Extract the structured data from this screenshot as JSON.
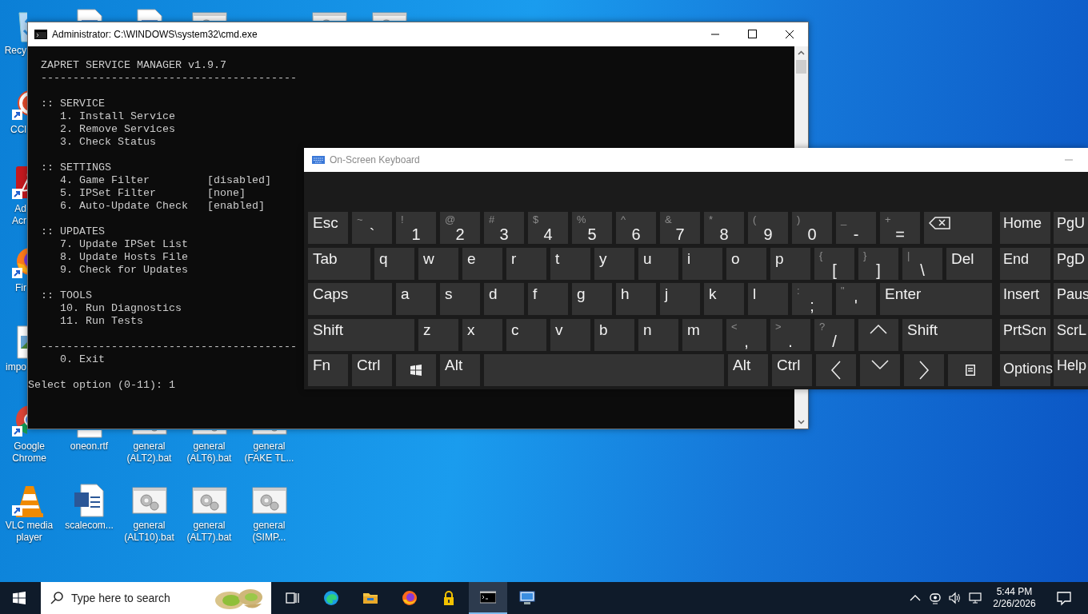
{
  "desktop_icons": [
    {
      "kind": "recycle-bin",
      "label": "Recy"
    },
    {
      "kind": "document"
    },
    {
      "kind": "document"
    },
    {
      "kind": "batch"
    },
    {
      "kind": "batch"
    },
    {
      "kind": "batch"
    },
    {
      "kind": "cleaner",
      "label": "CCl"
    },
    {
      "kind": "pdf",
      "label": "Ad Acr"
    },
    {
      "kind": "firefox",
      "label": "Fir"
    },
    {
      "kind": "image",
      "label": "impo"
    },
    {
      "kind": "chrome",
      "label": "Google Chrome"
    },
    {
      "kind": "rtf",
      "label": "oneon.rtf"
    },
    {
      "kind": "batch",
      "label": "general (ALT2).bat"
    },
    {
      "kind": "batch",
      "label": "general (ALT6).bat"
    },
    {
      "kind": "batch",
      "label": "general (FAKE TL..."
    },
    {
      "kind": "vlc",
      "label": "VLC media player"
    },
    {
      "kind": "word",
      "label": "scalecom..."
    },
    {
      "kind": "batch",
      "label": "general (ALT10).bat"
    },
    {
      "kind": "batch",
      "label": "general (ALT7).bat"
    },
    {
      "kind": "batch",
      "label": "general (SIMP..."
    }
  ],
  "console_window": {
    "title": "Administrator: C:\\WINDOWS\\system32\\cmd.exe",
    "heading": "ZAPRET SERVICE MANAGER v1.9.7",
    "rule": "----------------------------------------",
    "sections": [
      {
        "title": ":: SERVICE",
        "items": [
          {
            "label": "1. Install Service"
          },
          {
            "label": "2. Remove Services"
          },
          {
            "label": "3. Check Status"
          }
        ]
      },
      {
        "title": ":: SETTINGS",
        "items": [
          {
            "label": "4. Game Filter",
            "value": "[disabled]"
          },
          {
            "label": "5. IPSet Filter",
            "value": "[none]"
          },
          {
            "label": "6. Auto-Update Check",
            "value": "[enabled]"
          }
        ]
      },
      {
        "title": ":: UPDATES",
        "items": [
          {
            "label": "7. Update IPSet List"
          },
          {
            "label": "8. Update Hosts File"
          },
          {
            "label": "9. Check for Updates"
          }
        ]
      },
      {
        "title": ":: TOOLS",
        "items": [
          {
            "label": "10. Run Diagnostics"
          },
          {
            "label": "11. Run Tests"
          }
        ]
      }
    ],
    "footer_rule": "----------------------------------------",
    "exit_item": "0. Exit",
    "prompt": "Select option (0-11): 1"
  },
  "keyboard_window": {
    "title": "On-Screen Keyboard",
    "main_rows": [
      {
        "keys": [
          {
            "kind": "function",
            "label": "Esc"
          },
          {
            "kind": "symbol",
            "shift": "~",
            "base": "`"
          },
          {
            "kind": "symbol",
            "shift": "!",
            "base": "1"
          },
          {
            "kind": "symbol",
            "shift": "@",
            "base": "2"
          },
          {
            "kind": "symbol",
            "shift": "#",
            "base": "3"
          },
          {
            "kind": "symbol",
            "shift": "$",
            "base": "4"
          },
          {
            "kind": "symbol",
            "shift": "%",
            "base": "5"
          },
          {
            "kind": "symbol",
            "shift": "^",
            "base": "6"
          },
          {
            "kind": "symbol",
            "shift": "&",
            "base": "7"
          },
          {
            "kind": "symbol",
            "shift": "*",
            "base": "8"
          },
          {
            "kind": "symbol",
            "shift": "(",
            "base": "9"
          },
          {
            "kind": "symbol",
            "shift": ")",
            "base": "0"
          },
          {
            "kind": "symbol",
            "shift": "_",
            "base": "-"
          },
          {
            "kind": "symbol",
            "shift": "+",
            "base": "="
          },
          {
            "kind": "backspace"
          }
        ]
      },
      {
        "keys": [
          {
            "kind": "function",
            "label": "Tab"
          },
          {
            "kind": "letter",
            "label": "q"
          },
          {
            "kind": "letter",
            "label": "w"
          },
          {
            "kind": "letter",
            "label": "e"
          },
          {
            "kind": "letter",
            "label": "r"
          },
          {
            "kind": "letter",
            "label": "t"
          },
          {
            "kind": "letter",
            "label": "y"
          },
          {
            "kind": "letter",
            "label": "u"
          },
          {
            "kind": "letter",
            "label": "i"
          },
          {
            "kind": "letter",
            "label": "o"
          },
          {
            "kind": "letter",
            "label": "p"
          },
          {
            "kind": "symbol",
            "shift": "{",
            "base": "["
          },
          {
            "kind": "symbol",
            "shift": "}",
            "base": "]"
          },
          {
            "kind": "symbol",
            "shift": "|",
            "base": "\\"
          },
          {
            "kind": "function",
            "label": "Del"
          }
        ]
      },
      {
        "keys": [
          {
            "kind": "function",
            "label": "Caps"
          },
          {
            "kind": "letter",
            "label": "a"
          },
          {
            "kind": "letter",
            "label": "s"
          },
          {
            "kind": "letter",
            "label": "d"
          },
          {
            "kind": "letter",
            "label": "f"
          },
          {
            "kind": "letter",
            "label": "g"
          },
          {
            "kind": "letter",
            "label": "h"
          },
          {
            "kind": "letter",
            "label": "j"
          },
          {
            "kind": "letter",
            "label": "k"
          },
          {
            "kind": "letter",
            "label": "l"
          },
          {
            "kind": "symbol",
            "shift": ":",
            "base": ";"
          },
          {
            "kind": "symbol",
            "shift": "\"",
            "base": "'"
          },
          {
            "kind": "function",
            "label": "Enter"
          }
        ]
      },
      {
        "keys": [
          {
            "kind": "function",
            "label": "Shift"
          },
          {
            "kind": "letter",
            "label": "z"
          },
          {
            "kind": "letter",
            "label": "x"
          },
          {
            "kind": "letter",
            "label": "c"
          },
          {
            "kind": "letter",
            "label": "v"
          },
          {
            "kind": "letter",
            "label": "b"
          },
          {
            "kind": "letter",
            "label": "n"
          },
          {
            "kind": "letter",
            "label": "m"
          },
          {
            "kind": "symbol",
            "shift": "<",
            "base": ","
          },
          {
            "kind": "symbol",
            "shift": ">",
            "base": "."
          },
          {
            "kind": "symbol",
            "shift": "?",
            "base": "/"
          },
          {
            "kind": "up"
          },
          {
            "kind": "function",
            "label": "Shift"
          }
        ]
      },
      {
        "keys": [
          {
            "kind": "function",
            "label": "Fn"
          },
          {
            "kind": "function",
            "label": "Ctrl"
          },
          {
            "kind": "windows"
          },
          {
            "kind": "function",
            "label": "Alt"
          },
          {
            "kind": "space"
          },
          {
            "kind": "function",
            "label": "Alt"
          },
          {
            "kind": "function",
            "label": "Ctrl"
          },
          {
            "kind": "left"
          },
          {
            "kind": "down"
          },
          {
            "kind": "right"
          },
          {
            "kind": "menu"
          }
        ]
      }
    ],
    "side_rows": [
      {
        "keys": [
          {
            "kind": "function",
            "label": "Home"
          },
          {
            "kind": "function",
            "label": "PgU"
          }
        ]
      },
      {
        "keys": [
          {
            "kind": "function",
            "label": "End"
          },
          {
            "kind": "function",
            "label": "PgD"
          }
        ]
      },
      {
        "keys": [
          {
            "kind": "function",
            "label": "Insert"
          },
          {
            "kind": "function",
            "label": "Paus"
          }
        ]
      },
      {
        "keys": [
          {
            "kind": "function",
            "label": "PrtScn"
          },
          {
            "kind": "function",
            "label": "ScrL"
          }
        ]
      },
      {
        "keys": [
          {
            "kind": "option",
            "label": "Options"
          },
          {
            "kind": "function",
            "label": "Help"
          }
        ]
      }
    ]
  },
  "taskbar": {
    "search": {
      "placeholder": "Type here to search"
    },
    "apps": [
      {
        "kind": "task-view",
        "selected": false
      },
      {
        "kind": "swirl",
        "selected": false
      },
      {
        "kind": "folder",
        "selected": false
      },
      {
        "kind": "fox",
        "selected": false
      },
      {
        "kind": "padlock",
        "selected": false
      },
      {
        "kind": "terminal",
        "selected": true
      },
      {
        "kind": "monitor",
        "selected": false
      }
    ],
    "clock": {
      "time": "5:44 PM",
      "date": "2/26/2026"
    }
  }
}
